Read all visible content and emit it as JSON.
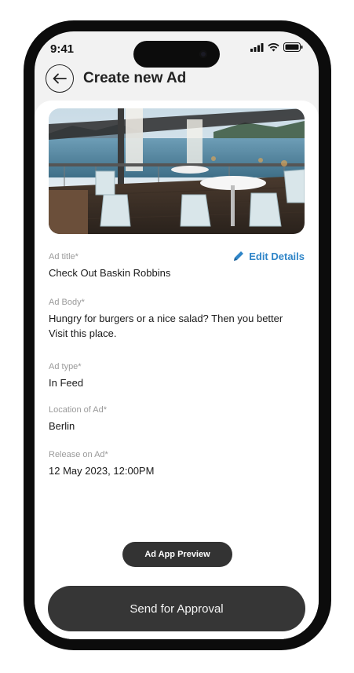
{
  "status": {
    "time": "9:41"
  },
  "header": {
    "title": "Create new Ad"
  },
  "edit": {
    "label": "Edit Details"
  },
  "fields": [
    {
      "label": "Ad title*",
      "value": "Check Out Baskin Robbins"
    },
    {
      "label": "Ad Body*",
      "value": "Hungry for burgers or a nice salad? Then you better Visit this place."
    },
    {
      "label": "Ad type*",
      "value": "In Feed"
    },
    {
      "label": "Location of Ad*",
      "value": "Berlin"
    },
    {
      "label": "Release on Ad*",
      "value": "12 May 2023, 12:00PM"
    }
  ],
  "actions": {
    "preview_label": "Ad App Preview",
    "submit_label": "Send for Approval"
  },
  "colors": {
    "accent": "#2f85c8",
    "button": "#363636",
    "background": "#f2f2f2"
  },
  "icons": [
    "back-arrow-icon",
    "pencil-icon",
    "signal-icon",
    "wifi-icon",
    "battery-icon"
  ]
}
